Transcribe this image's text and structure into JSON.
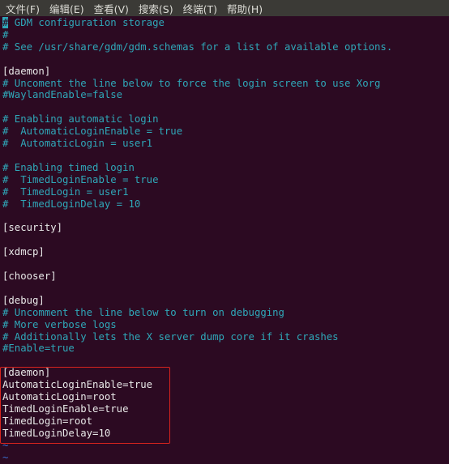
{
  "menu": [
    "文件(F)",
    "编辑(E)",
    "查看(V)",
    "搜索(S)",
    "终端(T)",
    "帮助(H)"
  ],
  "lines": [
    {
      "text": "# GDM configuration storage",
      "kind": "comment"
    },
    {
      "text": "#",
      "kind": "comment"
    },
    {
      "text": "# See /usr/share/gdm/gdm.schemas for a list of available options.",
      "kind": "comment"
    },
    {
      "text": "",
      "kind": "blank"
    },
    {
      "text": "[daemon]",
      "kind": "normal"
    },
    {
      "text": "# Uncoment the line below to force the login screen to use Xorg",
      "kind": "comment"
    },
    {
      "text": "#WaylandEnable=false",
      "kind": "comment"
    },
    {
      "text": "",
      "kind": "blank"
    },
    {
      "text": "# Enabling automatic login",
      "kind": "comment"
    },
    {
      "text": "#  AutomaticLoginEnable = true",
      "kind": "comment"
    },
    {
      "text": "#  AutomaticLogin = user1",
      "kind": "comment"
    },
    {
      "text": "",
      "kind": "blank"
    },
    {
      "text": "# Enabling timed login",
      "kind": "comment"
    },
    {
      "text": "#  TimedLoginEnable = true",
      "kind": "comment"
    },
    {
      "text": "#  TimedLogin = user1",
      "kind": "comment"
    },
    {
      "text": "#  TimedLoginDelay = 10",
      "kind": "comment"
    },
    {
      "text": "",
      "kind": "blank"
    },
    {
      "text": "[security]",
      "kind": "normal"
    },
    {
      "text": "",
      "kind": "blank"
    },
    {
      "text": "[xdmcp]",
      "kind": "normal"
    },
    {
      "text": "",
      "kind": "blank"
    },
    {
      "text": "[chooser]",
      "kind": "normal"
    },
    {
      "text": "",
      "kind": "blank"
    },
    {
      "text": "[debug]",
      "kind": "normal"
    },
    {
      "text": "# Uncomment the line below to turn on debugging",
      "kind": "comment"
    },
    {
      "text": "# More verbose logs",
      "kind": "comment"
    },
    {
      "text": "# Additionally lets the X server dump core if it crashes",
      "kind": "comment"
    },
    {
      "text": "#Enable=true",
      "kind": "comment"
    },
    {
      "text": "",
      "kind": "blank"
    },
    {
      "text": "[daemon]",
      "kind": "normal"
    },
    {
      "text": "AutomaticLoginEnable=true",
      "kind": "normal"
    },
    {
      "text": "AutomaticLogin=root",
      "kind": "normal"
    },
    {
      "text": "TimedLoginEnable=true",
      "kind": "normal"
    },
    {
      "text": "TimedLogin=root",
      "kind": "normal"
    },
    {
      "text": "TimedLoginDelay=10",
      "kind": "normal"
    },
    {
      "text": "~",
      "kind": "tilde"
    },
    {
      "text": "~",
      "kind": "tilde"
    }
  ],
  "colors": {
    "background": "#2c0a22",
    "comment": "#2fa7b8",
    "highlight_box": "#d8241e"
  }
}
